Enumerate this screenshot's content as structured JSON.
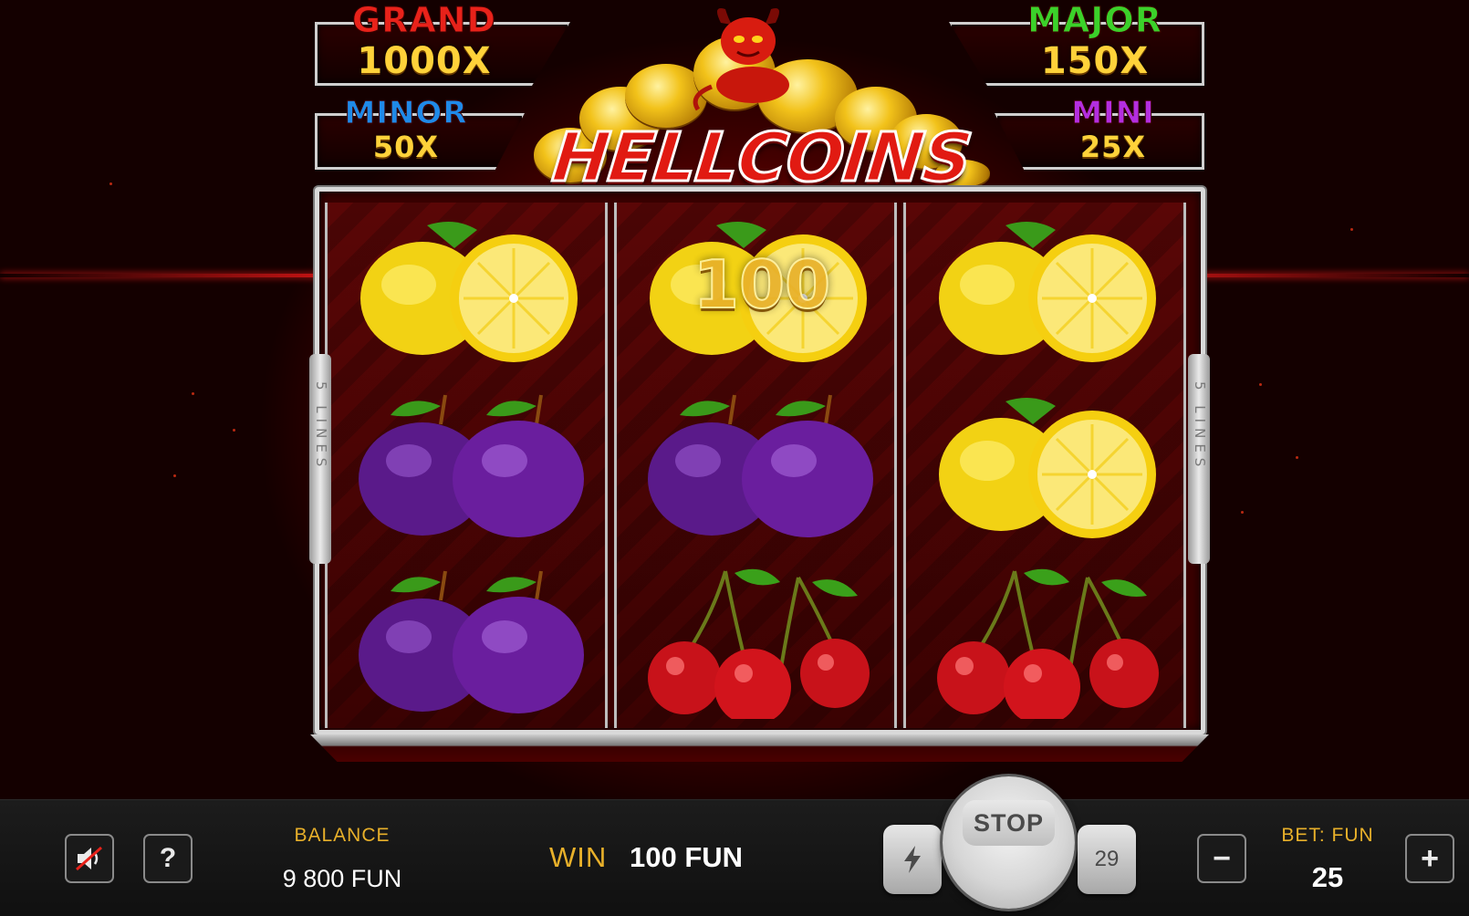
{
  "jackpots": {
    "grand": {
      "title": "GRAND",
      "value": "1000X",
      "color": "#e8221a"
    },
    "major": {
      "title": "MAJOR",
      "value": "150X",
      "color": "#3bd12a"
    },
    "minor": {
      "title": "MINOR",
      "value": "50X",
      "color": "#1f8ae8"
    },
    "mini": {
      "title": "MINI",
      "value": "25X",
      "color": "#b42ee0"
    }
  },
  "logo": {
    "text": "HELLCOINS"
  },
  "reels": {
    "side_label": "5 LINES",
    "side_label_left": "5 LINES",
    "grid": [
      [
        "lemon",
        "plum",
        "plum"
      ],
      [
        "lemon",
        "plum",
        "cherry"
      ],
      [
        "lemon",
        "lemon",
        "cherry"
      ]
    ],
    "win_overlay": "100"
  },
  "bottom_bar": {
    "balance_label": "BALANCE",
    "balance_value": "9 800 FUN",
    "win_label": "WIN",
    "win_value": "100 FUN",
    "stop_label": "STOP",
    "autospin_count": "29",
    "bet_label": "BET: FUN",
    "bet_value": "25",
    "help_label": "?",
    "minus_label": "−",
    "plus_label": "+"
  },
  "icons": {
    "sound": "sound-muted-icon",
    "turbo": "lightning-icon",
    "help": "question-icon"
  },
  "colors": {
    "accent_gold": "#e8b02a",
    "reel_bg": "#4a0404",
    "bar_bg": "#161616"
  }
}
